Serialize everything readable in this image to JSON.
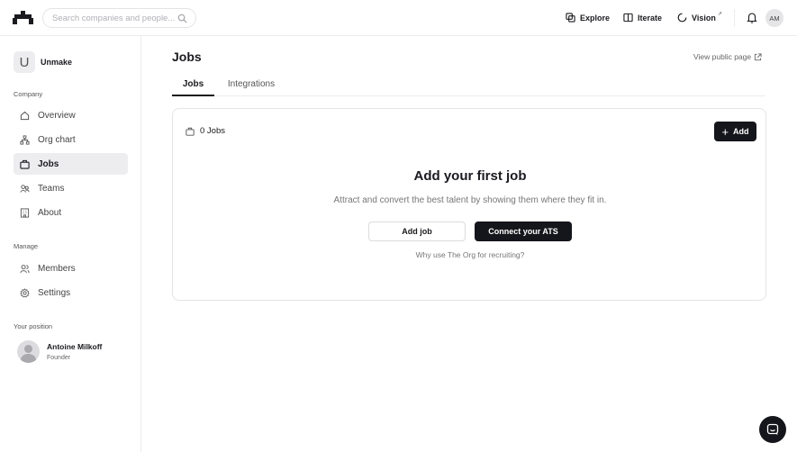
{
  "topbar": {
    "search_placeholder": "Search companies and people...",
    "nav": {
      "explore": "Explore",
      "iterate": "Iterate",
      "vision": "Vision",
      "vision_ext": "↗"
    },
    "user_initials": "AM"
  },
  "sidebar": {
    "company_initial": "U",
    "company_name": "Unmake",
    "company_section": "Company",
    "items": [
      {
        "label": "Overview",
        "icon": "home-icon"
      },
      {
        "label": "Org chart",
        "icon": "org-chart-icon"
      },
      {
        "label": "Jobs",
        "icon": "briefcase-icon",
        "active": true
      },
      {
        "label": "Teams",
        "icon": "teams-icon"
      },
      {
        "label": "About",
        "icon": "building-icon"
      }
    ],
    "manage_section": "Manage",
    "manage_items": [
      {
        "label": "Members",
        "icon": "members-icon"
      },
      {
        "label": "Settings",
        "icon": "gear-icon"
      }
    ],
    "position_section": "Your position",
    "position": {
      "name": "Antoine Milkoff",
      "role": "Founder"
    }
  },
  "main": {
    "title": "Jobs",
    "public_link": "View public page",
    "tabs": [
      {
        "label": "Jobs",
        "active": true
      },
      {
        "label": "Integrations",
        "active": false
      }
    ],
    "card": {
      "jobs_count": "0 Jobs",
      "add_label": "Add",
      "empty_title": "Add your first job",
      "empty_subtitle": "Attract and convert the best talent by showing them where they fit in.",
      "add_job_label": "Add job",
      "connect_ats_label": "Connect your ATS",
      "why_link": "Why use The Org for recruiting?"
    }
  },
  "colors": {
    "primary_dark": "#15151c",
    "active_bg": "#ededf0",
    "border": "#e4e4e8"
  }
}
